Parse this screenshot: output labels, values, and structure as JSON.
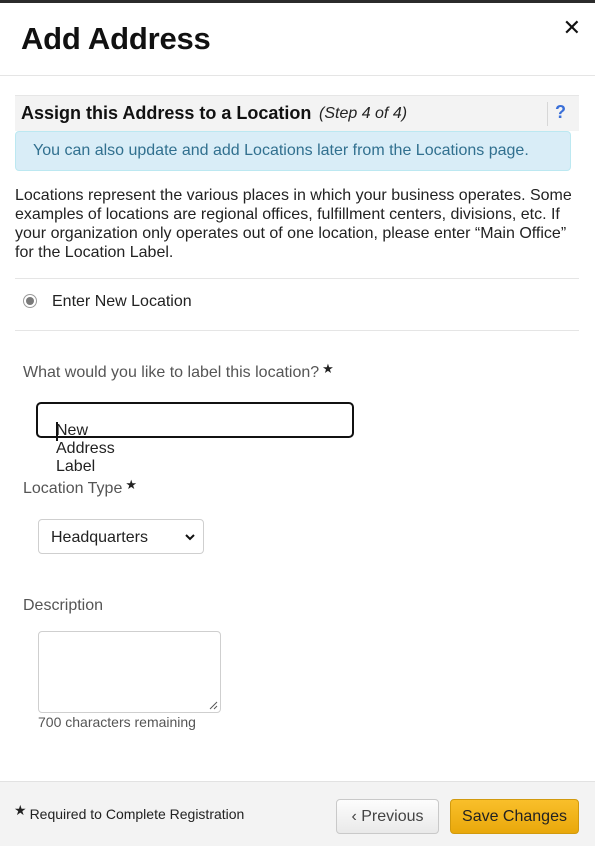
{
  "dialog": {
    "title": "Add Address",
    "close_icon": "close-icon"
  },
  "step": {
    "title": "Assign this Address to a Location",
    "count": "(Step 4 of 4)",
    "help_label": "?"
  },
  "info_alert": "You can also update and add Locations later from the Locations page.",
  "description_text": "Locations represent the various places in which your business operates. Some examples of locations are regional offices, fulfillment centers, divisions, etc. If your organization only operates out of one location, please enter “Main Office” for the Location Label.",
  "location_choice": {
    "label": "Enter New Location",
    "selected": true
  },
  "form": {
    "label_question": "What would you like to label this location?",
    "label_value": "New Address Label",
    "location_type_label": "Location Type",
    "location_type_value": "Headquarters",
    "description_label": "Description",
    "description_value": "",
    "chars_remaining": "700 characters remaining",
    "required_star": "★"
  },
  "footer": {
    "required_note": "Required to Complete Registration",
    "previous_label": "‹ Previous",
    "save_label": "Save Changes"
  },
  "colors": {
    "accent_button": "#f0b21a",
    "info_bg": "#d9edf7",
    "info_text": "#31708f",
    "help_icon": "#3a6fd8"
  }
}
